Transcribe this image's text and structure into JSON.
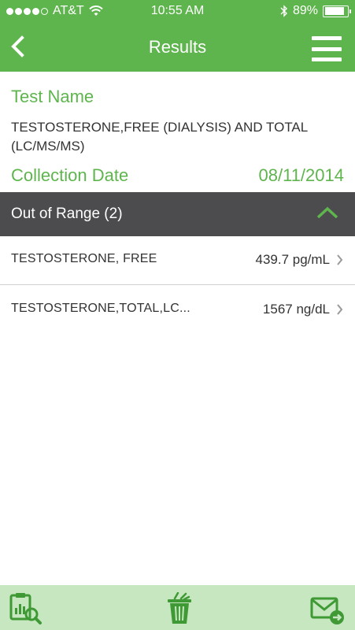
{
  "status_bar": {
    "carrier": "AT&T",
    "time": "10:55 AM",
    "battery": "89%",
    "battery_level": 0.89,
    "signal_dots_filled": 4,
    "signal_dots_total": 5
  },
  "nav": {
    "title": "Results",
    "back_icon": "chevron-left-icon",
    "menu_icon": "hamburger-menu-icon"
  },
  "test": {
    "name_label": "Test Name",
    "name_value": "TESTOSTERONE,FREE (DIALYSIS) AND TOTAL (LC/MS/MS)",
    "collection_label": "Collection Date",
    "collection_date": "08/11/2014"
  },
  "section": {
    "title": "Out of Range (2)",
    "expanded": true
  },
  "results": [
    {
      "name": "TESTOSTERONE, FREE",
      "value": "439.7 pg/mL"
    },
    {
      "name": "TESTOSTERONE,TOTAL,LC...",
      "value": "1567 ng/dL"
    }
  ],
  "toolbar": {
    "report_icon": "report-search-icon",
    "trash_icon": "trash-icon",
    "mail_icon": "mail-send-icon"
  },
  "colors": {
    "brand_green": "#5fb54d",
    "header_dark": "#4c4c4e",
    "toolbar_bg": "#c6e7c0",
    "icon_green": "#3f9a35"
  }
}
